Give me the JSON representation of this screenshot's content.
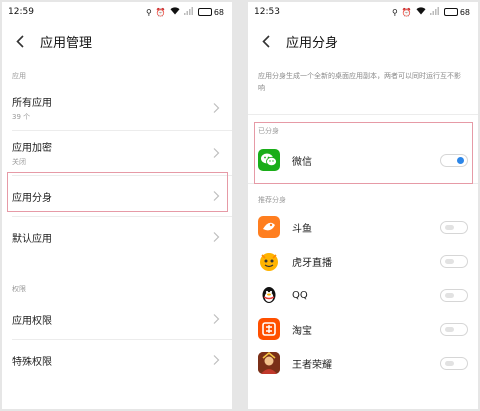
{
  "left": {
    "status": {
      "time": "12:59",
      "battery": "68"
    },
    "title": "应用管理",
    "sections": [
      {
        "label": "应用",
        "items": [
          {
            "title": "所有应用",
            "sub": "39 个"
          },
          {
            "title": "应用加密",
            "sub": "关闭"
          },
          {
            "title": "应用分身",
            "sub": ""
          },
          {
            "title": "默认应用",
            "sub": ""
          }
        ]
      },
      {
        "label": "权限",
        "items": [
          {
            "title": "应用权限",
            "sub": ""
          },
          {
            "title": "特殊权限",
            "sub": ""
          }
        ]
      }
    ]
  },
  "right": {
    "status": {
      "time": "12:53",
      "battery": "68"
    },
    "title": "应用分身",
    "description": "应用分身生成一个全新的桌面应用副本，两者可以同时运行互不影响",
    "cloned": {
      "label": "已分身",
      "apps": [
        {
          "name": "微信",
          "icon": "wechat-icon",
          "enabled": true
        }
      ]
    },
    "recommended": {
      "label": "推荐分身",
      "apps": [
        {
          "name": "斗鱼",
          "icon": "douyu-icon",
          "enabled": false
        },
        {
          "name": "虎牙直播",
          "icon": "huya-icon",
          "enabled": false
        },
        {
          "name": "QQ",
          "icon": "qq-icon",
          "enabled": false
        },
        {
          "name": "淘宝",
          "icon": "taobao-icon",
          "enabled": false
        },
        {
          "name": "王者荣耀",
          "icon": "honor-of-kings-icon",
          "enabled": false
        }
      ]
    }
  },
  "colors": {
    "accent": "#2c86e8",
    "highlight": "#e69aa6",
    "wechat": "#1aad19",
    "douyu": "#ff7e1f",
    "huya": "#ffb400",
    "taobao": "#ff5000"
  }
}
